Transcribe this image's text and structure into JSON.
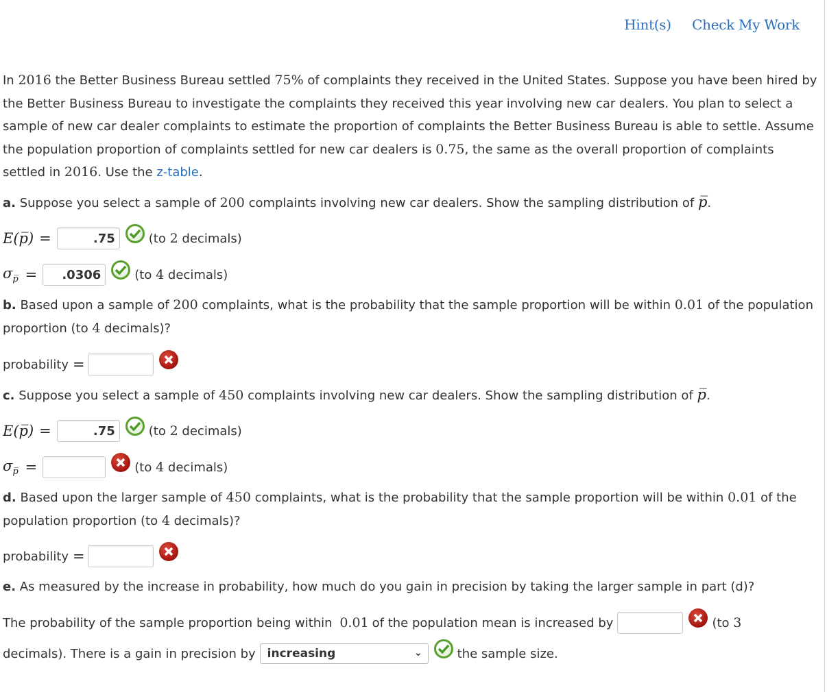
{
  "header": {
    "hint_label": "Hint(s)",
    "check_label": "Check My Work"
  },
  "intro": {
    "t1": "In ",
    "year": "2016",
    "t2": " the Better Business Bureau settled ",
    "pct": "75%",
    "t3": " of complaints they received in the United States. Suppose you have been hired by the Better Business Bureau to investigate the complaints they received this year involving new car dealers. You plan to select a sample of new car dealer complaints to estimate the proportion of complaints the Better Business Bureau is able to settle. Assume the population proportion of complaints settled for new car dealers is ",
    "p": "0.75",
    "t4": ", the same as the overall proportion of complaints settled in ",
    "year2": "2016",
    "t5": ". Use the ",
    "link": "z-table",
    "t6": "."
  },
  "part_a": {
    "label": "a.",
    "t1": " Suppose you select a sample of ",
    "n": "200",
    "t2": " complaints involving new car dealers. Show the sampling distribution of ",
    "sym": "p̅",
    "t3": ".",
    "e_label": "E(p̅)",
    "e_value": ".75",
    "e_status": "correct",
    "e_hint_a": "(to ",
    "e_hint_n": "2",
    "e_hint_b": " decimals)",
    "s_label": "σ",
    "s_sub": "p̅",
    "s_value": ".0306",
    "s_status": "correct",
    "s_hint_a": "(to ",
    "s_hint_n": "4",
    "s_hint_b": " decimals)"
  },
  "part_b": {
    "label": "b.",
    "t1": " Based upon a sample of ",
    "n": "200",
    "t2": " complaints, what is the probability that the sample proportion will be within ",
    "d": "0.01",
    "t3": " of the population proportion (to ",
    "dec": "4",
    "t4": " decimals)?",
    "prob_label": "probability",
    "prob_value": "",
    "prob_status": "incorrect"
  },
  "part_c": {
    "label": "c.",
    "t1": " Suppose you select a sample of ",
    "n": "450",
    "t2": " complaints involving new car dealers. Show the sampling distribution of ",
    "sym": "p̅",
    "t3": ".",
    "e_value": ".75",
    "e_status": "correct",
    "s_value": "",
    "s_status": "incorrect"
  },
  "part_d": {
    "label": "d.",
    "t1": " Based upon the larger sample of ",
    "n": "450",
    "t2": " complaints, what is the probability that the sample proportion will be within ",
    "d": "0.01",
    "t3": " of the population proportion (to ",
    "dec": "4",
    "t4": " decimals)?",
    "prob_label": "probability",
    "prob_value": "",
    "prob_status": "incorrect"
  },
  "part_e": {
    "label": "e.",
    "t1": " As measured by the increase in probability, how much do you gain in precision by taking the larger sample in part (d)?",
    "s1": "The probability of the sample proportion being within ",
    "d": "0.01",
    "s2": " of the population mean is increased by",
    "inc_value": "",
    "inc_status": "incorrect",
    "s3a": "(to ",
    "s3n": "3",
    "s4": "decimals). There is a gain in precision by",
    "select_value": "increasing",
    "select_status": "correct",
    "s5": "the sample size."
  }
}
